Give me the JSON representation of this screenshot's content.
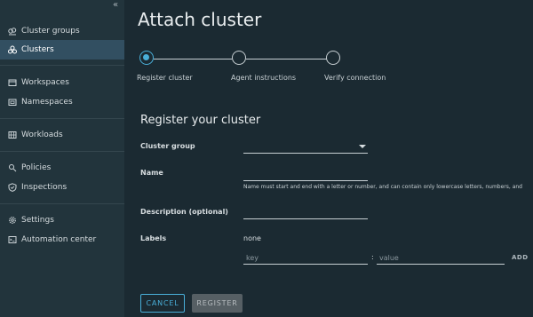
{
  "sidebar": {
    "collapse_glyph": "«",
    "items": [
      {
        "label": "Cluster groups",
        "icon": "cluster-groups-icon",
        "active": false
      },
      {
        "label": "Clusters",
        "icon": "clusters-icon",
        "active": true
      },
      {
        "label": "Workspaces",
        "icon": "workspaces-icon",
        "active": false
      },
      {
        "label": "Namespaces",
        "icon": "namespaces-icon",
        "active": false
      },
      {
        "label": "Workloads",
        "icon": "workloads-icon",
        "active": false
      },
      {
        "label": "Policies",
        "icon": "policies-icon",
        "active": false
      },
      {
        "label": "Inspections",
        "icon": "inspections-icon",
        "active": false
      },
      {
        "label": "Settings",
        "icon": "gear-icon",
        "active": false
      },
      {
        "label": "Automation center",
        "icon": "automation-center-icon",
        "active": false
      }
    ]
  },
  "page": {
    "title": "Attach cluster"
  },
  "stepper": {
    "steps": [
      {
        "label": "Register cluster",
        "state": "active"
      },
      {
        "label": "Agent instructions",
        "state": "pending"
      },
      {
        "label": "Verify connection",
        "state": "pending"
      }
    ]
  },
  "form": {
    "section_title": "Register your cluster",
    "cluster_group_label": "Cluster group",
    "cluster_group_value": "",
    "name_label": "Name",
    "name_value": "",
    "name_helper": "Name must start and end with a letter or number, and can contain only lowercase letters, numbers, and",
    "description_label": "Description (optional)",
    "description_value": "",
    "labels_label": "Labels",
    "labels_value": "none",
    "key_placeholder": "key",
    "value_placeholder": "value",
    "kv_separator": ":",
    "add_label": "ADD"
  },
  "actions": {
    "cancel_label": "CANCEL",
    "register_label": "REGISTER"
  },
  "colors": {
    "accent": "#49afd9",
    "sidebar_bg": "#22343c",
    "main_bg": "#1b2a32",
    "active_nav_bg": "#324f61"
  }
}
